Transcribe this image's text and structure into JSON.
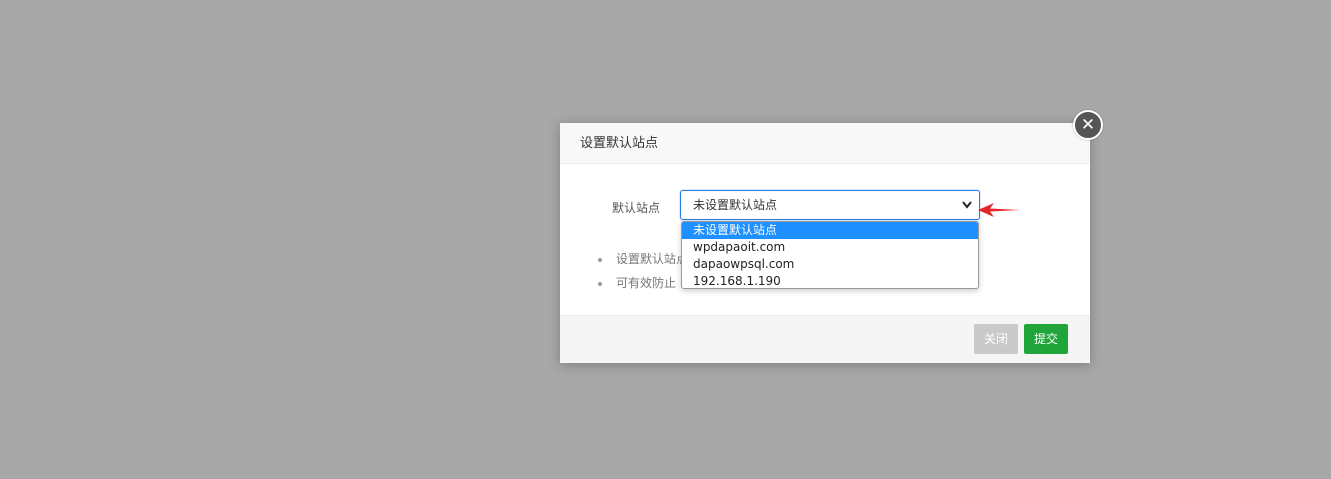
{
  "dialog": {
    "title": "设置默认站点",
    "close_icon": "✕",
    "field_label": "默认站点",
    "select_value": "未设置默认站点",
    "chevron_icon": "⌄",
    "tips": [
      "设置默认站点",
      "可有效防止"
    ],
    "close_button": "关闭",
    "submit_button": "提交"
  },
  "dropdown": {
    "options": [
      "未设置默认站点",
      "wpdapaoit.com",
      "dapaowpsql.com",
      "192.168.1.190"
    ],
    "selected_index": 0
  },
  "colors": {
    "overlay": "#a8a8a8",
    "submit": "#20a53a",
    "close_button": "#c9c9c9",
    "selected_option": "#1e90ff",
    "arrow": "#e8242b"
  }
}
